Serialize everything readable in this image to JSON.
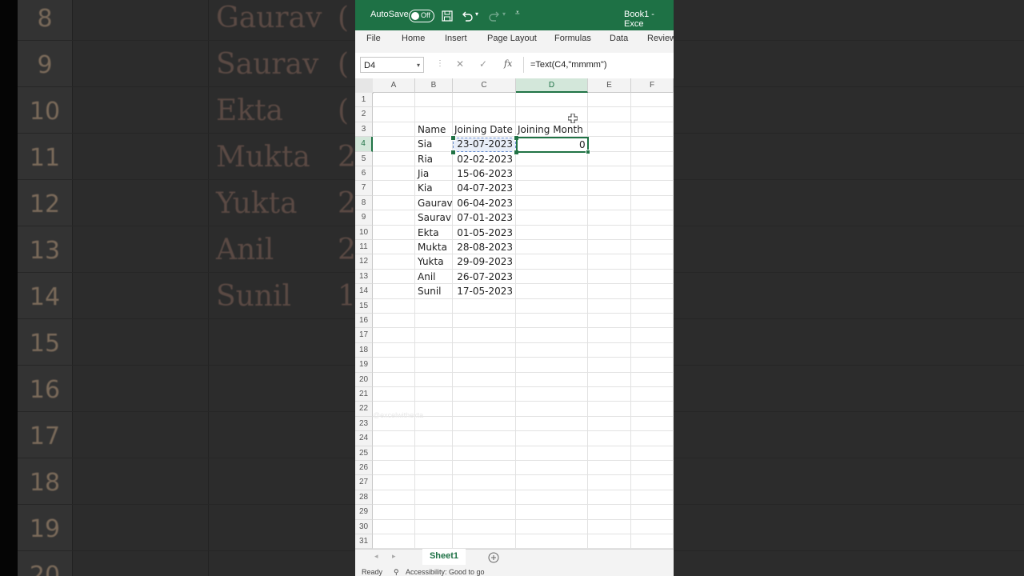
{
  "background": {
    "rows": [
      {
        "num": "8",
        "name": "Gaurav",
        "frag": "("
      },
      {
        "num": "9",
        "name": "Saurav",
        "frag": "("
      },
      {
        "num": "10",
        "name": "Ekta",
        "frag": "("
      },
      {
        "num": "11",
        "name": "Mukta",
        "frag": "2"
      },
      {
        "num": "12",
        "name": "Yukta",
        "frag": "2"
      },
      {
        "num": "13",
        "name": "Anil",
        "frag": "2"
      },
      {
        "num": "14",
        "name": "Sunil",
        "frag": "1"
      },
      {
        "num": "15",
        "name": "",
        "frag": ""
      },
      {
        "num": "16",
        "name": "",
        "frag": ""
      },
      {
        "num": "17",
        "name": "",
        "frag": ""
      },
      {
        "num": "18",
        "name": "",
        "frag": ""
      },
      {
        "num": "19",
        "name": "",
        "frag": ""
      },
      {
        "num": "20",
        "name": "",
        "frag": ""
      }
    ]
  },
  "titlebar": {
    "autosave_label": "AutoSave",
    "toggle_state": "Off",
    "title": "Book1 - Exce",
    "color": "#1e7145"
  },
  "ribbon": {
    "tabs": [
      "File",
      "Home",
      "Insert",
      "Page Layout",
      "Formulas",
      "Data",
      "Review"
    ]
  },
  "formula_bar": {
    "name_box": "D4",
    "fx_label": "fx",
    "formula": "=Text(C4,\"mmmm\")"
  },
  "columns": [
    "A",
    "B",
    "C",
    "D",
    "E",
    "F"
  ],
  "selected_column": "D",
  "selected_row": "4",
  "row_numbers": [
    "1",
    "2",
    "3",
    "4",
    "5",
    "6",
    "7",
    "8",
    "9",
    "10",
    "11",
    "12",
    "13",
    "14",
    "15",
    "16",
    "17",
    "18",
    "19",
    "20",
    "21",
    "22",
    "23",
    "24",
    "25",
    "26",
    "27",
    "28",
    "29",
    "30",
    "31"
  ],
  "headers": {
    "name": "Name",
    "date": "Joining Date",
    "month": "Joining Month"
  },
  "records": [
    {
      "name": "Sia",
      "date": "23-07-2023"
    },
    {
      "name": "Ria",
      "date": "02-02-2023"
    },
    {
      "name": "Jia",
      "date": "15-06-2023"
    },
    {
      "name": "Kia",
      "date": "04-07-2023"
    },
    {
      "name": "Gaurav",
      "date": "06-04-2023"
    },
    {
      "name": "Saurav",
      "date": "07-01-2023"
    },
    {
      "name": "Ekta",
      "date": "01-05-2023"
    },
    {
      "name": "Mukta",
      "date": "28-08-2023"
    },
    {
      "name": "Yukta",
      "date": "29-09-2023"
    },
    {
      "name": "Anil",
      "date": "26-07-2023"
    },
    {
      "name": "Sunil",
      "date": "17-05-2023"
    }
  ],
  "active_cell_value": "0",
  "sheet_tab": "Sheet1",
  "status": {
    "ready": "Ready",
    "accessibility": "Accessibility: Good to go"
  },
  "watermark": "@excelwithekta"
}
